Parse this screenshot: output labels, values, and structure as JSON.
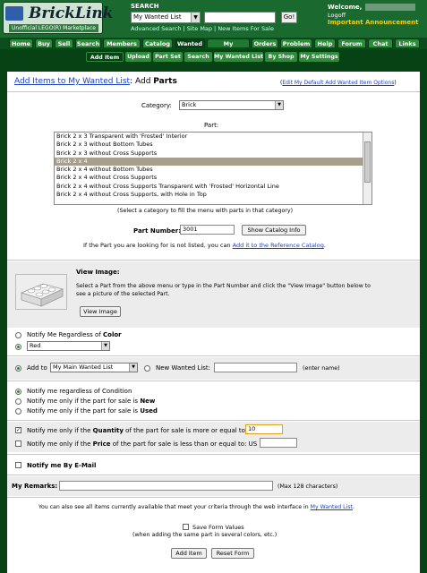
{
  "header": {
    "logo_text": "BrickLink",
    "logo_sub": "Unofficial LEGO(R) Marketplace",
    "search_label": "SEARCH",
    "search_select": "My Wanted List",
    "search_input_value": "",
    "go_label": "Go!",
    "links": [
      "Advanced Search",
      "Site Map",
      "New Items For Sale"
    ],
    "welcome": "Welcome,",
    "logoff": "Logoff",
    "announcement": "Important Announcement"
  },
  "nav": {
    "items": [
      "Home",
      "Buy",
      "Sell",
      "Search",
      "Members",
      "Catalog",
      "Wanted",
      "My BrickLink",
      "Orders",
      "Problem",
      "Help",
      "Forum",
      "Chat",
      "Links"
    ]
  },
  "subnav": {
    "items": [
      "Add Item",
      "Upload",
      "Part Set",
      "Search",
      "My Wanted List",
      "By Shop",
      "My Settings"
    ]
  },
  "page": {
    "title_link": "Add Items to My Wanted List",
    "title_rest": ": Add ",
    "title_bold": "Parts",
    "edit_defaults_link": "Edit My Default Add Wanted Item Options",
    "category_label": "Category:",
    "category_value": "Brick",
    "part_label": "Part:",
    "part_list": [
      "Brick 2 x 3 Transparent with 'Frosted' Interior",
      "Brick 2 x 3 without Bottom Tubes",
      "Brick 2 x 3 without Cross Supports",
      "Brick 2 x 4",
      "Brick 2 x 4 without Bottom Tubes",
      "Brick 2 x 4 without Cross Supports",
      "Brick 2 x 4 without Cross Supports Transparent with 'Frosted' Horizontal Line",
      "Brick 2 x 4 without Cross Supports, with Hole in Top"
    ],
    "part_hint": "(Select a category to fill the menu with parts in that category)",
    "part_number_label": "Part Number:",
    "part_number_value": "3001",
    "show_catalog_info": "Show Catalog Info",
    "not_listed_text": "If the Part you are looking for is not listed, you can",
    "add_reference_link": "Add it to the Reference Catalog",
    "view_image_title": "View Image:",
    "view_image_desc1": "Select a Part from the above menu or type in the Part Number and click the \"View Image\" button below to",
    "view_image_desc2": "see a picture of the selected Part.",
    "view_image_button": "View Image",
    "color_any_pre": "Notify Me Regardless of ",
    "color_any_bold": "Color",
    "color_value": "Red",
    "add_to_label": "Add to",
    "add_to_value": "My Main Wanted List",
    "new_list_label": "New Wanted List:",
    "new_list_value": "",
    "enter_name": "(enter name)",
    "cond_any": "Notify me regardless of Condition",
    "cond_new_pre": "Notify me only if the part for sale is ",
    "cond_new_bold": "New",
    "cond_used_pre": "Notify me only if the part for sale is ",
    "cond_used_bold": "Used",
    "qty_pre": "Notify me only if the ",
    "qty_bold": "Quantity",
    "qty_post": " of the part for sale is more or equal to:",
    "qty_value": "10",
    "price_pre": "Notify me only if the ",
    "price_bold": "Price",
    "price_post": " of the part for sale is less than or equal to: US $",
    "price_value": "",
    "email_label": "Notify me By E-Mail",
    "remarks_label": "My Remarks:",
    "remarks_value": "",
    "remarks_max": "(Max 128 characters)",
    "web_text": "You can also see all items currently available that meet your criteria through the web interface in",
    "web_link": "My Wanted List",
    "save_form": "Save Form Values",
    "save_form_hint": "(when adding the same part in several colors, etc.)",
    "add_item_button": "Add Item",
    "reset_button": "Reset Form"
  },
  "colors": {
    "header_green": "#1a6a2f",
    "nav_dark": "#0b4d1f",
    "tab_green": "#2e8b3c",
    "link_blue": "#1a3fbf",
    "announcement": "#ffcc00",
    "selected_row": "#a79f8e"
  }
}
